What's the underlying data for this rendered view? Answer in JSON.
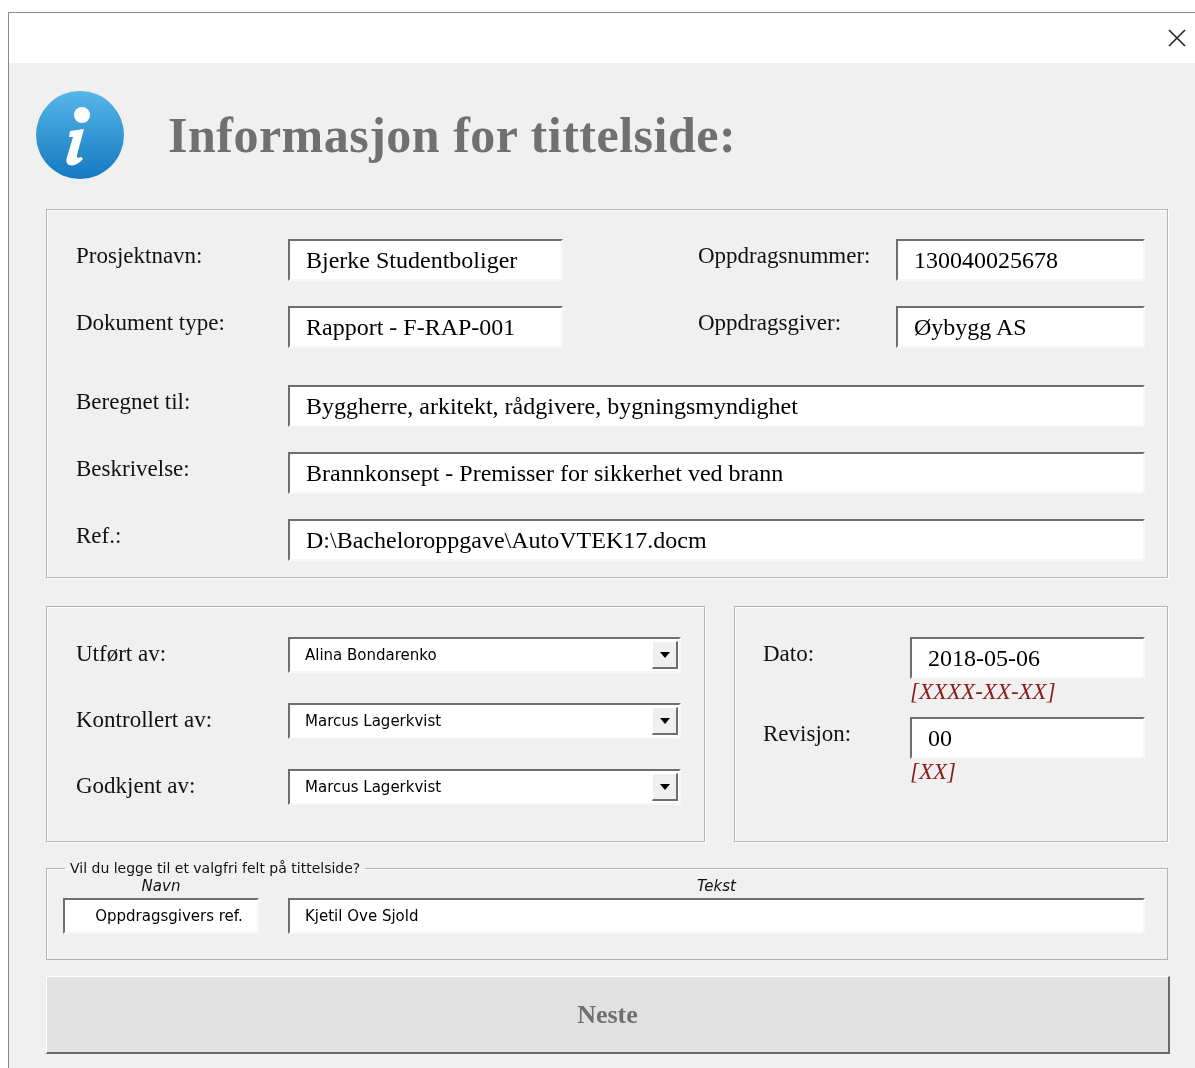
{
  "header": {
    "title": "Informasjon for tittelside:"
  },
  "project_fields": [
    {
      "kind": "pair",
      "items": [
        {
          "label": "Prosjektnavn:",
          "value": "Bjerke Studentboliger"
        },
        {
          "label": "Oppdragsnummer:",
          "value": "130040025678"
        }
      ]
    },
    {
      "kind": "pair",
      "items": [
        {
          "label": "Dokument type:",
          "value": "Rapport - F-RAP-001"
        },
        {
          "label": "Oppdragsgiver:",
          "value": "Øybygg AS"
        }
      ]
    },
    {
      "kind": "full",
      "items": [
        {
          "label": "Beregnet til:",
          "value": "Byggherre, arkitekt, rådgivere, bygningsmyndighet"
        }
      ]
    },
    {
      "kind": "full",
      "items": [
        {
          "label": "Beskrivelse:",
          "value": "Brannkonsept - Premisser for sikkerhet ved brann"
        }
      ]
    },
    {
      "kind": "full",
      "items": [
        {
          "label": "Ref.:",
          "value": "D:\\Bacheloroppgave\\AutoVTEK17.docm"
        }
      ]
    }
  ],
  "people": [
    {
      "label": "Utført av:",
      "value": "Alina Bondarenko"
    },
    {
      "label": "Kontrollert av:",
      "value": "Marcus Lagerkvist"
    },
    {
      "label": "Godkjent av:",
      "value": "Marcus Lagerkvist"
    }
  ],
  "dates": [
    {
      "label": "Dato:",
      "value": "2018-05-06",
      "hint": "[XXXX-XX-XX]"
    },
    {
      "label": "Revisjon:",
      "value": "00",
      "hint": "[XX]"
    }
  ],
  "optional": {
    "legend": "Vil du legge til et valgfri felt på tittelside?",
    "name_header": "Navn",
    "text_header": "Tekst",
    "name_value": "Oppdragsgivers ref.",
    "text_value": "Kjetil Ove Sjold"
  },
  "next_button": {
    "label": "Neste"
  }
}
